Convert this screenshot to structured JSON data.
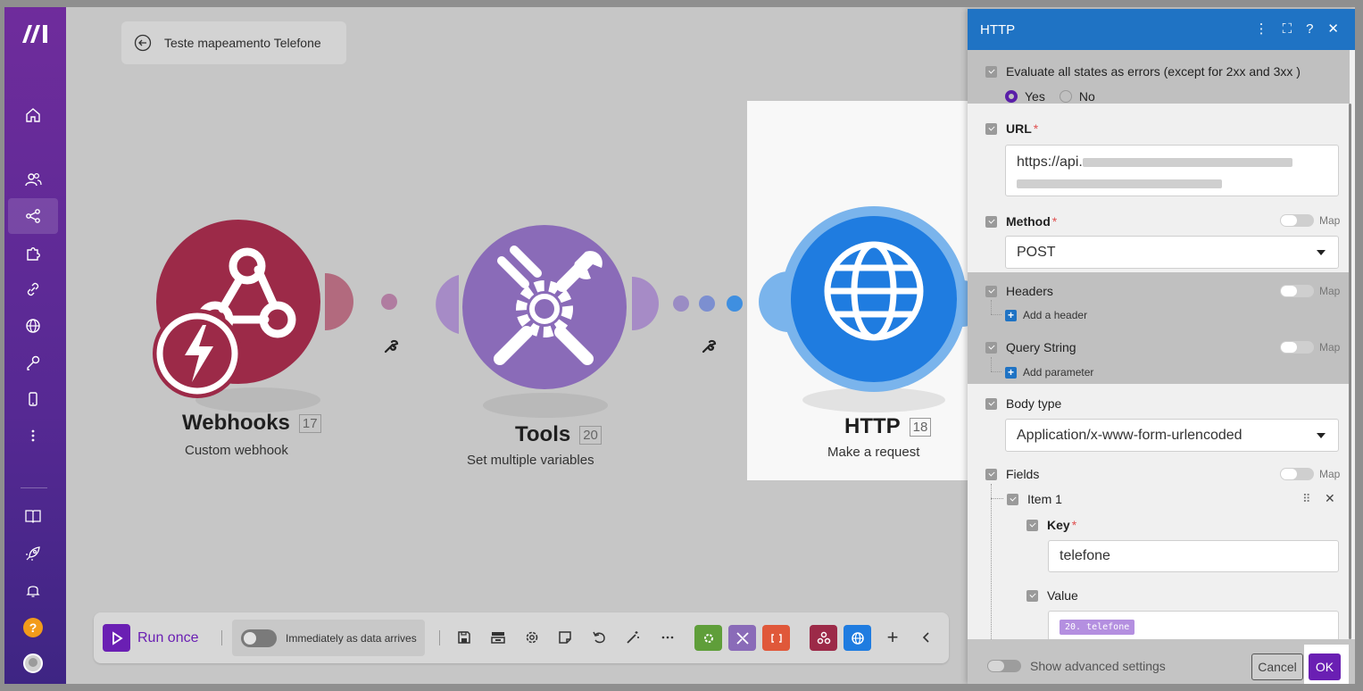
{
  "scenario": {
    "title": "Teste mapeamento Telefone"
  },
  "modules": [
    {
      "name": "Webhooks",
      "id": "17",
      "subtitle": "Custom webhook"
    },
    {
      "name": "Tools",
      "id": "20",
      "subtitle": "Set multiple variables"
    },
    {
      "name": "HTTP",
      "id": "18",
      "subtitle": "Make a request"
    }
  ],
  "toolbar": {
    "run_label": "Run once",
    "schedule_label": "Immediately as data arrives"
  },
  "panel": {
    "title": "HTTP",
    "evaluate_label": "Evaluate all states as errors (except for 2xx and 3xx )",
    "yes_label": "Yes",
    "no_label": "No",
    "url_label": "URL",
    "url_value_prefix": "https://api.",
    "method_label": "Method",
    "method_value": "POST",
    "map_label": "Map",
    "headers_label": "Headers",
    "add_header_label": "Add a header",
    "query_label": "Query String",
    "add_param_label": "Add parameter",
    "body_type_label": "Body type",
    "body_type_value": "Application/x-www-form-urlencoded",
    "fields_label": "Fields",
    "item_label": "Item 1",
    "key_label": "Key",
    "key_value": "telefone",
    "value_label": "Value",
    "value_pill": "20. telefone",
    "advanced_label": "Show advanced settings",
    "cancel_label": "Cancel",
    "ok_label": "OK"
  },
  "colors": {
    "webhooks": "#9c2a48",
    "tools": "#8a6bb8",
    "http": "#1f7ce0",
    "accent": "#6a1fb3"
  }
}
